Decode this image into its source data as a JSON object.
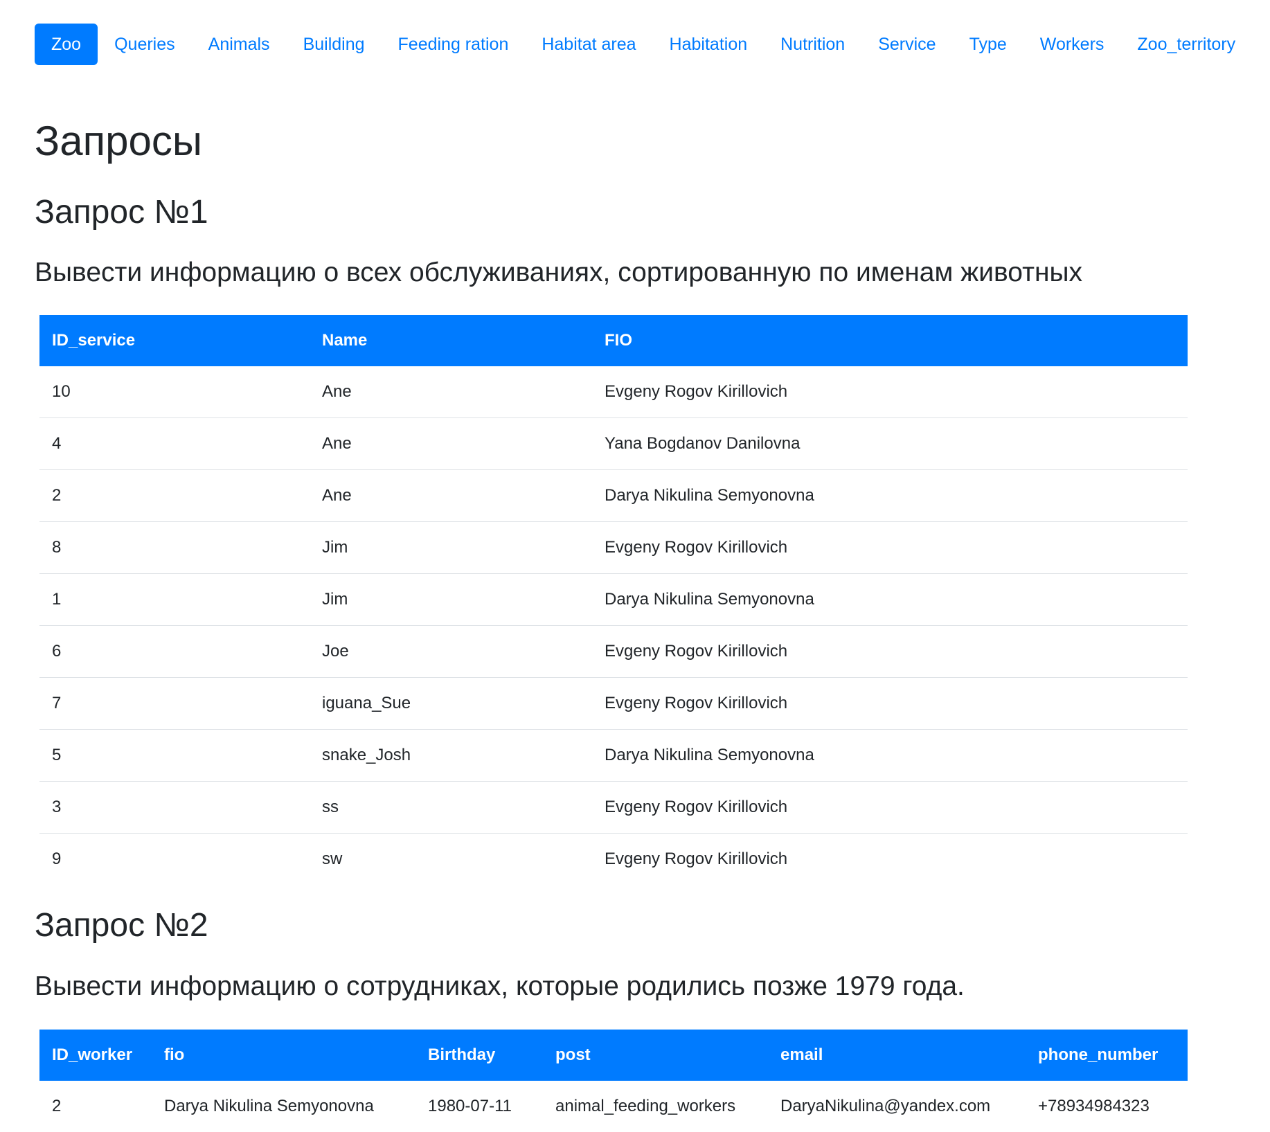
{
  "nav": {
    "items": [
      "Zoo",
      "Queries",
      "Animals",
      "Building",
      "Feeding ration",
      "Habitat area",
      "Habitation",
      "Nutrition",
      "Service",
      "Type",
      "Workers",
      "Zoo_territory"
    ]
  },
  "page_title": "Запросы",
  "query1": {
    "heading": "Запрос №1",
    "description": "Вывести информацию о всех обслуживаниях, сортированную по именам животных",
    "columns": [
      "ID_service",
      "Name",
      "FIO"
    ],
    "rows": [
      [
        "10",
        "Ane",
        "Evgeny Rogov Kirillovich"
      ],
      [
        "4",
        "Ane",
        "Yana Bogdanov Danilovna"
      ],
      [
        "2",
        "Ane",
        "Darya Nikulina Semyonovna"
      ],
      [
        "8",
        "Jim",
        "Evgeny Rogov Kirillovich"
      ],
      [
        "1",
        "Jim",
        "Darya Nikulina Semyonovna"
      ],
      [
        "6",
        "Joe",
        "Evgeny Rogov Kirillovich"
      ],
      [
        "7",
        "iguana_Sue",
        "Evgeny Rogov Kirillovich"
      ],
      [
        "5",
        "snake_Josh",
        "Darya Nikulina Semyonovna"
      ],
      [
        "3",
        "ss",
        "Evgeny Rogov Kirillovich"
      ],
      [
        "9",
        "sw",
        "Evgeny Rogov Kirillovich"
      ]
    ]
  },
  "query2": {
    "heading": "Запрос №2",
    "description": "Вывести информацию о сотрудниках, которые родились позже 1979 года.",
    "columns": [
      "ID_worker",
      "fio",
      "Birthday",
      "post",
      "email",
      "phone_number"
    ],
    "rows": [
      [
        "2",
        "Darya Nikulina Semyonovna",
        "1980-07-11",
        "animal_feeding_workers",
        "DaryaNikulina@yandex.com",
        "+78934984323"
      ]
    ]
  },
  "colors": {
    "accent": "#007bff",
    "text": "#212529",
    "border": "#dee2e6"
  }
}
